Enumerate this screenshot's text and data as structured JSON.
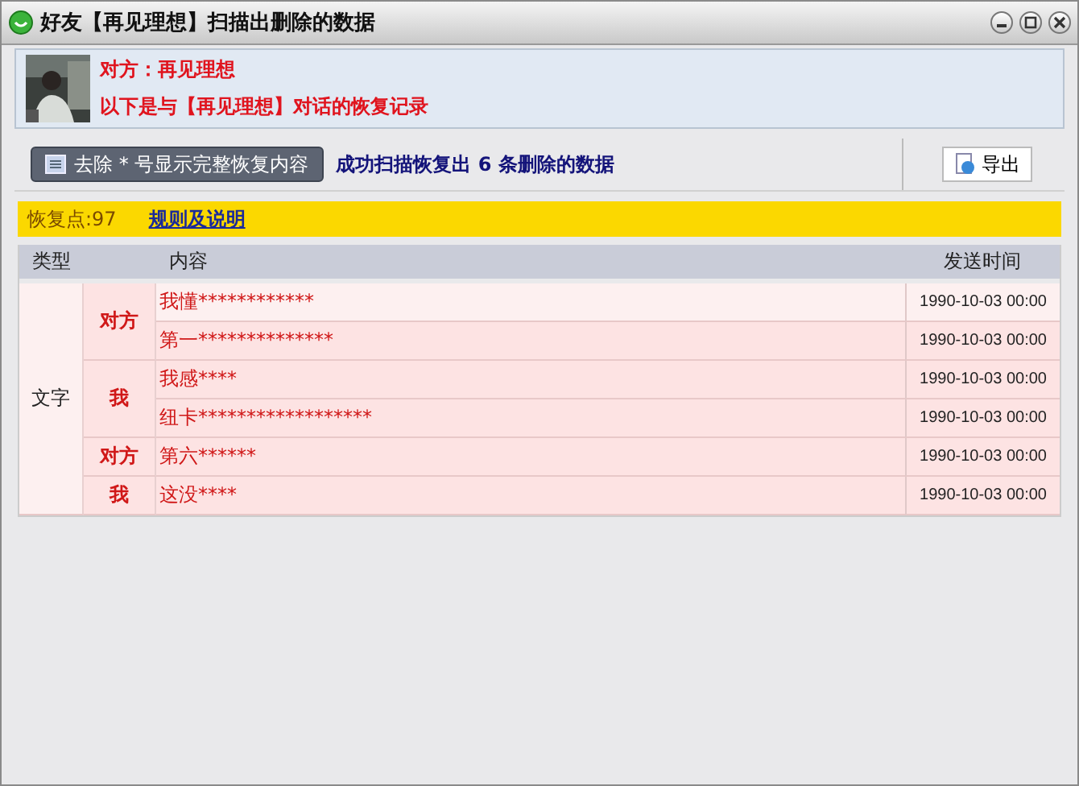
{
  "window": {
    "title": "好友【再见理想】扫描出删除的数据"
  },
  "header": {
    "contact_line": "对方：再见理想",
    "subtitle": "以下是与【再见理想】对话的恢复记录"
  },
  "toolbar": {
    "toggle_button": "去除 * 号显示完整恢复内容",
    "status": "成功扫描恢复出 6 条删除的数据",
    "export_button": "导出"
  },
  "notice_bar": {
    "recovery_point": "恢复点:97",
    "link": "规则及说明"
  },
  "table": {
    "columns": [
      "类型",
      "内容",
      "发送时间"
    ],
    "groups": [
      {
        "type": "文字",
        "senders": [
          {
            "sender": "对方",
            "messages": [
              {
                "content": "我懂************",
                "time": "1990-10-03 00:00",
                "selected": true
              },
              {
                "content": "第一**************",
                "time": "1990-10-03 00:00",
                "selected": false
              }
            ]
          },
          {
            "sender": "我",
            "messages": [
              {
                "content": "我感****",
                "time": "1990-10-03 00:00",
                "selected": false
              },
              {
                "content": "纽卡******************",
                "time": "1990-10-03 00:00",
                "selected": false
              }
            ]
          },
          {
            "sender": "对方",
            "messages": [
              {
                "content": "第六******",
                "time": "1990-10-03 00:00",
                "selected": false
              }
            ]
          },
          {
            "sender": "我",
            "messages": [
              {
                "content": "这没****",
                "time": "1990-10-03 00:00",
                "selected": false
              }
            ]
          }
        ]
      }
    ]
  }
}
